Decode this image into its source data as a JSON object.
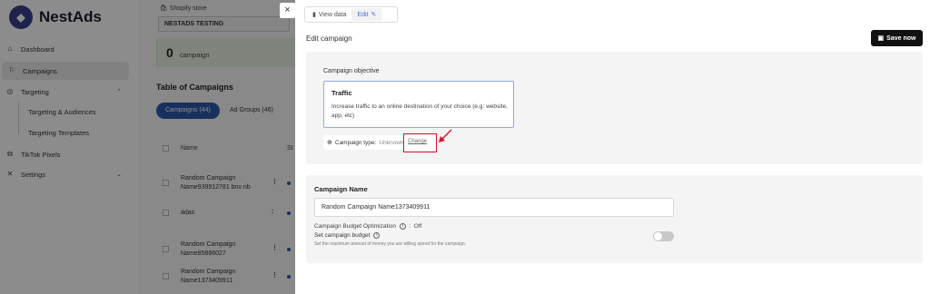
{
  "app": {
    "name": "NestAds",
    "sidebar": {
      "items": [
        {
          "label": "Dashboard",
          "icon": "home-icon"
        },
        {
          "label": "Campaigns",
          "icon": "flag-icon"
        },
        {
          "label": "Targeting",
          "icon": "target-icon"
        },
        {
          "label": "TikTok Pixels",
          "icon": "code-icon"
        },
        {
          "label": "Settings",
          "icon": "tools-icon"
        }
      ],
      "targeting_sub": [
        "Targeting & Audiences",
        "Targeting Templates"
      ]
    },
    "store": {
      "label": "Shopify store",
      "value": "NESTADS TESTING"
    },
    "summary": {
      "count": "0",
      "label": "campaign"
    },
    "table": {
      "title": "Table of Campaigns",
      "tabs": [
        "Campaigns (44)",
        "Ad Groups (46)"
      ],
      "header_name": "Name",
      "header_status": "St",
      "rows": [
        {
          "line1": "Random Campaign",
          "line2": "Name939912781 bnv nb"
        },
        {
          "line1": "ádas",
          "line2": ""
        },
        {
          "line1": "Random Campaign",
          "line2": "Name85886027"
        },
        {
          "line1": "Random Campaign",
          "line2": "Name1373409911"
        }
      ]
    }
  },
  "drawer": {
    "close": "×",
    "toggle": {
      "view": "View data",
      "edit": "Edit"
    },
    "title": "Edit campaign",
    "save": "Save now",
    "objective": {
      "section_label": "Campaign objective",
      "name": "Traffic",
      "description": "Increase traffic to an online destination of your choice (e.g: website, app, etc)",
      "type_label": "Campaign type:",
      "type_value": "Unknown",
      "change": "Change"
    },
    "campaign_name": {
      "title": "Campaign Name",
      "value": "Random Campaign Name1373409911",
      "cbo_label": "Campaign Budget Optimization",
      "cbo_sep": ":",
      "cbo_value": "Off",
      "budget_label": "Set campaign budget",
      "budget_help": "Set the maximum amount of money you are willing spend for the campaign.",
      "budget_enabled": false
    }
  },
  "colors": {
    "accent": "#2d5aa8",
    "highlight": "#e0102a",
    "save_bg": "#111111"
  }
}
